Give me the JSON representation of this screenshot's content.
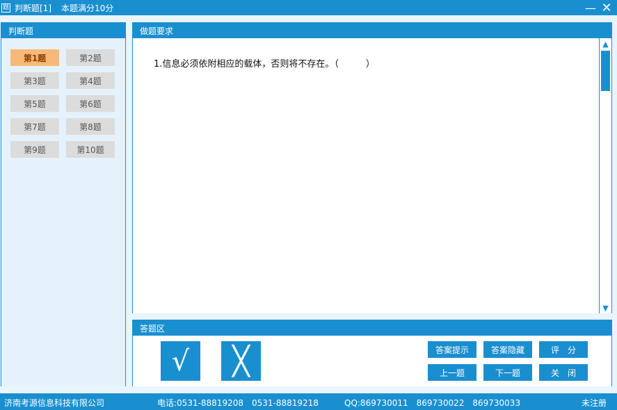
{
  "titlebar": {
    "icon_glyph": "题",
    "title": "判断题[1]",
    "score": "本题满分10分",
    "minimize_glyph": "—",
    "close_glyph": "✕"
  },
  "sidebar": {
    "title": "判断题",
    "questions": [
      {
        "label": "第1题",
        "active": true
      },
      {
        "label": "第2题",
        "active": false
      },
      {
        "label": "第3题",
        "active": false
      },
      {
        "label": "第4题",
        "active": false
      },
      {
        "label": "第5题",
        "active": false
      },
      {
        "label": "第6题",
        "active": false
      },
      {
        "label": "第7题",
        "active": false
      },
      {
        "label": "第8题",
        "active": false
      },
      {
        "label": "第9题",
        "active": false
      },
      {
        "label": "第10题",
        "active": false
      }
    ]
  },
  "requirements": {
    "title": "做题要求",
    "question_text": "1.信息必须依附相应的载体，否则将不存在。（　　　）",
    "scroll_up_glyph": "▲",
    "scroll_down_glyph": "▼"
  },
  "answer_area": {
    "title": "答题区",
    "true_glyph": "√",
    "false_glyph": "╳",
    "buttons": {
      "hint": "答案提示",
      "hide": "答案隐藏",
      "score": "评　分",
      "prev": "上一题",
      "next": "下一题",
      "close": "关　闭"
    }
  },
  "statusbar": {
    "company": "济南考源信息科技有限公司",
    "phone": "电话:0531-88819208　0531-88819218",
    "qq": "QQ:869730011　869730022　869730033",
    "registration": "未注册"
  },
  "colors": {
    "accent": "#1a8fd0",
    "active_question": "#f7b97a",
    "inactive_question": "#dcdcdc"
  }
}
